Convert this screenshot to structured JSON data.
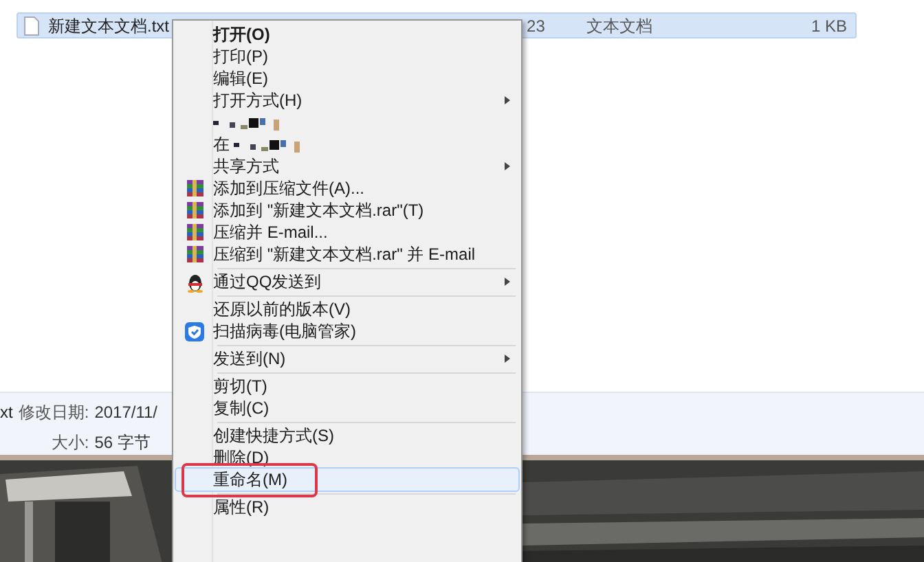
{
  "file_row": {
    "name": "新建文本文档.txt",
    "date_fragment": "23",
    "type": "文本文档",
    "size": "1 KB",
    "selected": true
  },
  "details": {
    "name_fragment": "xt",
    "modified_label": "修改日期:",
    "modified_value": "2017/11/",
    "size_label": "大小:",
    "size_value": "56 字节"
  },
  "context_menu": [
    {
      "kind": "item",
      "label": "打开(O)",
      "bold": true,
      "submenu": false,
      "selected": false,
      "circled": false
    },
    {
      "kind": "item",
      "label": "打印(P)",
      "bold": false,
      "submenu": false,
      "selected": false,
      "circled": false
    },
    {
      "kind": "item",
      "label": "编辑(E)",
      "bold": false,
      "submenu": false,
      "selected": false,
      "circled": false
    },
    {
      "kind": "item",
      "label": "打开方式(H)",
      "bold": false,
      "submenu": true,
      "selected": false,
      "circled": false
    },
    {
      "kind": "redacted"
    },
    {
      "kind": "redacted",
      "label": "在"
    },
    {
      "kind": "item",
      "label": "共享方式",
      "bold": false,
      "submenu": true,
      "selected": false,
      "circled": false
    },
    {
      "kind": "archive",
      "label": "添加到压缩文件(A)...",
      "bold": false,
      "submenu": false,
      "selected": false,
      "circled": false
    },
    {
      "kind": "archive",
      "label": "添加到 \"新建文本文档.rar\"(T)",
      "bold": false,
      "submenu": false,
      "selected": false,
      "circled": false
    },
    {
      "kind": "archive",
      "label": "压缩并 E-mail...",
      "bold": false,
      "submenu": false,
      "selected": false,
      "circled": false
    },
    {
      "kind": "archive",
      "label": "压缩到 \"新建文本文档.rar\" 并 E-mail",
      "bold": false,
      "submenu": false,
      "selected": false,
      "circled": false
    },
    {
      "kind": "separator"
    },
    {
      "kind": "penguin",
      "label": "通过QQ发送到",
      "bold": false,
      "submenu": true,
      "selected": false,
      "circled": false
    },
    {
      "kind": "separator"
    },
    {
      "kind": "item",
      "label": "还原以前的版本(V)",
      "bold": false,
      "submenu": false,
      "selected": false,
      "circled": false
    },
    {
      "kind": "shield",
      "label": "扫描病毒(电脑管家)",
      "bold": false,
      "submenu": false,
      "selected": false,
      "circled": false
    },
    {
      "kind": "separator"
    },
    {
      "kind": "item",
      "label": "发送到(N)",
      "bold": false,
      "submenu": true,
      "selected": false,
      "circled": false
    },
    {
      "kind": "separator"
    },
    {
      "kind": "item",
      "label": "剪切(T)",
      "bold": false,
      "submenu": false,
      "selected": false,
      "circled": false
    },
    {
      "kind": "item",
      "label": "复制(C)",
      "bold": false,
      "submenu": false,
      "selected": false,
      "circled": false
    },
    {
      "kind": "separator"
    },
    {
      "kind": "item",
      "label": "创建快捷方式(S)",
      "bold": false,
      "submenu": false,
      "selected": false,
      "circled": false
    },
    {
      "kind": "item",
      "label": "删除(D)",
      "bold": false,
      "submenu": false,
      "selected": false,
      "circled": false
    },
    {
      "kind": "item",
      "label": "重命名(M)",
      "bold": false,
      "submenu": false,
      "selected": true,
      "circled": true
    },
    {
      "kind": "separator"
    },
    {
      "kind": "item",
      "label": "属性(R)",
      "bold": false,
      "submenu": false,
      "selected": false,
      "circled": false
    }
  ]
}
